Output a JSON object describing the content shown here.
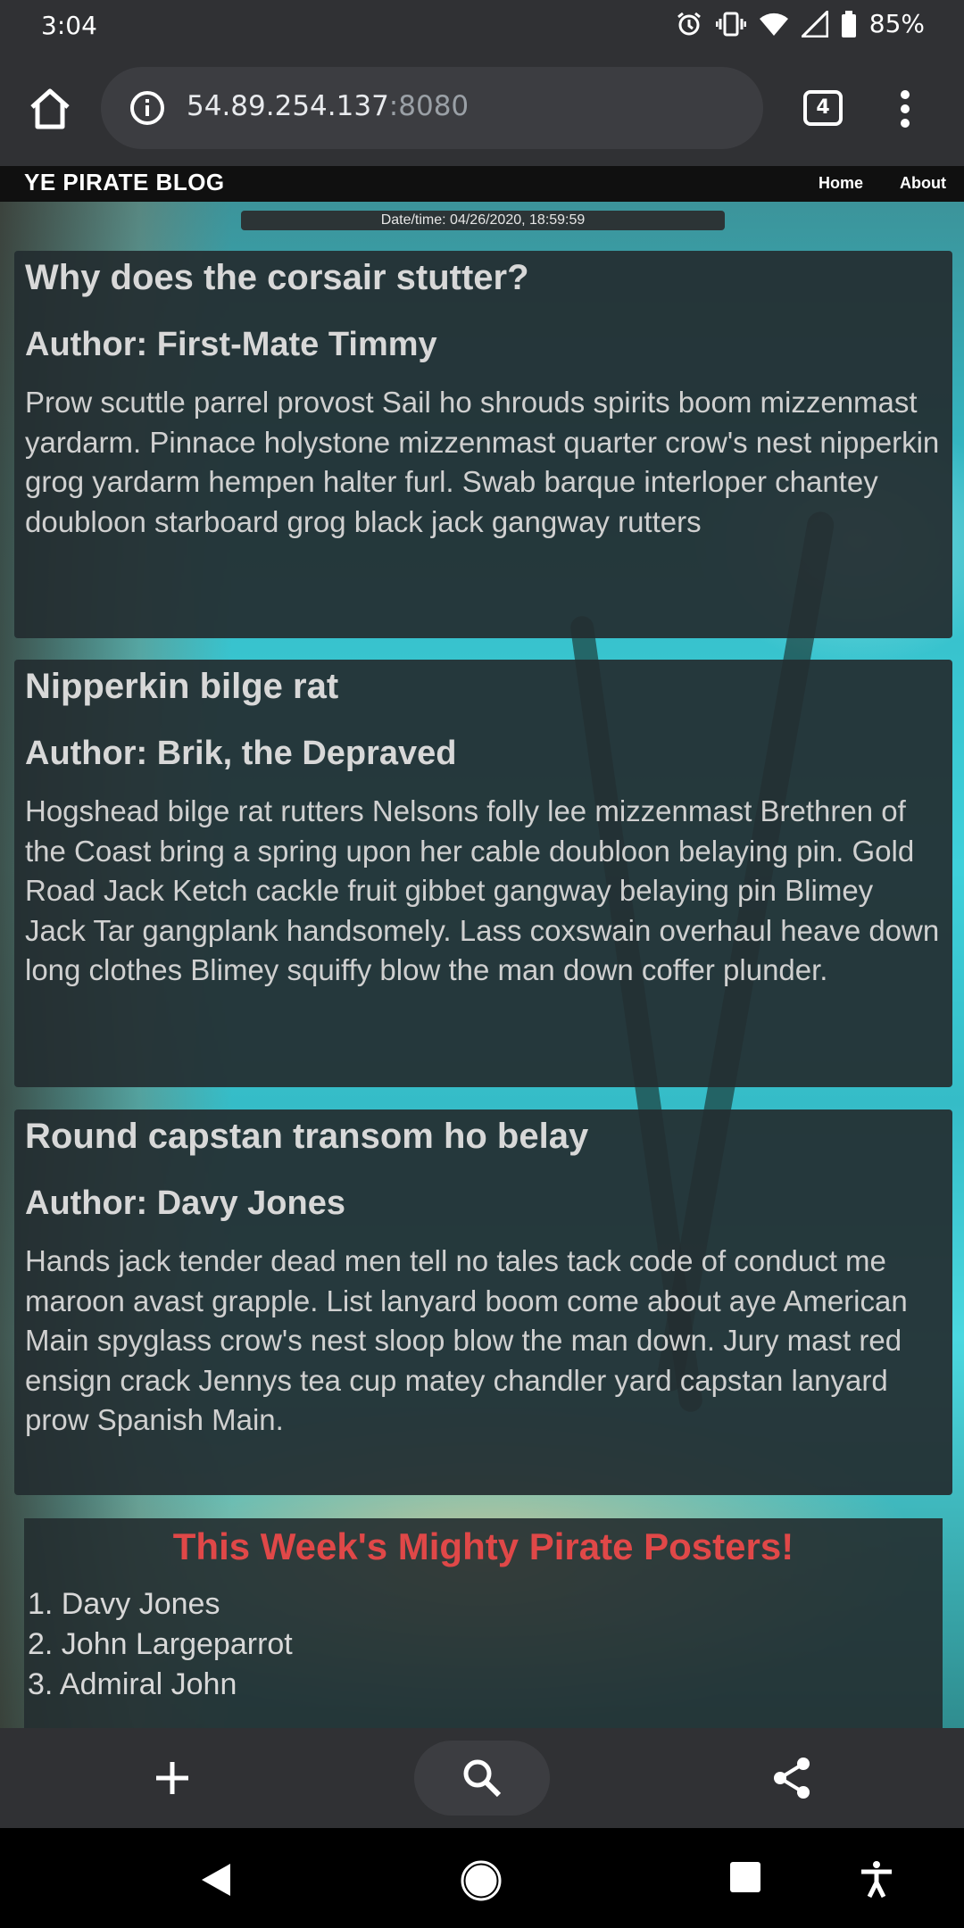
{
  "status_bar": {
    "time": "3:04",
    "battery": "85%"
  },
  "toolbar": {
    "url_host": "54.89.254.137",
    "url_port": ":8080",
    "tab_count": "4"
  },
  "site": {
    "brand": "YE PIRATE BLOG",
    "nav": [
      "Home",
      "About"
    ],
    "datetime": "Date/time: 04/26/2020, 18:59:59"
  },
  "posts": [
    {
      "title": "Why does the corsair stutter?",
      "author": "Author: First-Mate Timmy",
      "body": "Prow scuttle parrel provost Sail ho shrouds spirits boom mizzenmast yardarm. Pinnace holystone mizzenmast quarter crow's nest nipperkin grog yardarm hempen halter furl. Swab barque interloper chantey doubloon starboard grog black jack gangway rutters"
    },
    {
      "title": "Nipperkin bilge rat",
      "author": "Author: Brik, the Depraved",
      "body": "Hogshead bilge rat rutters Nelsons folly lee mizzenmast Brethren of the Coast bring a spring upon her cable doubloon belaying pin. Gold Road Jack Ketch cackle fruit gibbet gangway belaying pin Blimey Jack Tar gangplank handsomely. Lass coxswain overhaul heave down long clothes Blimey squiffy blow the man down coffer plunder."
    },
    {
      "title": "Round capstan transom ho belay",
      "author": "Author: Davy Jones",
      "body": "Hands jack tender dead men tell no tales tack code of conduct me maroon avast grapple. List lanyard boom come about aye American Main spyglass crow's nest sloop blow the man down. Jury mast red ensign crack Jennys tea cup matey chandler yard capstan lanyard prow Spanish Main."
    }
  ],
  "posters": {
    "title": "This Week's Mighty Pirate Posters!",
    "items": [
      "1. Davy Jones",
      "2. John Largeparrot",
      "3. Admiral John"
    ]
  },
  "colors": {
    "poster_title": "#e04848",
    "chrome_bg": "#303134",
    "nav_bg": "#101010"
  }
}
